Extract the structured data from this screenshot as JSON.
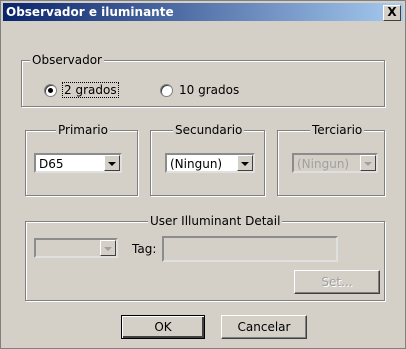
{
  "window": {
    "title": "Observador e iluminante",
    "close_label": "X"
  },
  "observer": {
    "legend": "Observador",
    "options": [
      {
        "label": "2 grados",
        "selected": true
      },
      {
        "label": "10 grados",
        "selected": false
      }
    ]
  },
  "primary": {
    "legend": "Primario",
    "value": "D65"
  },
  "secondary": {
    "legend": "Secundario",
    "value": "(Ningun)"
  },
  "tertiary": {
    "legend": "Terciario",
    "value": "(Ningun)"
  },
  "user_illuminant": {
    "legend": "User Illuminant Detail",
    "select_value": "",
    "tag_label": "Tag:",
    "tag_value": "",
    "set_label": "Set..."
  },
  "buttons": {
    "ok": "OK",
    "cancel": "Cancelar"
  }
}
